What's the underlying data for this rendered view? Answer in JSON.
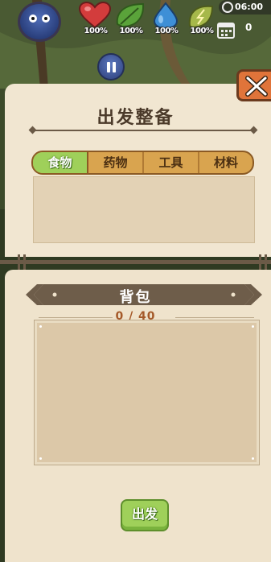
{
  "hud": {
    "stats": [
      {
        "name": "health",
        "percent": "100%",
        "color": "#d33c3c"
      },
      {
        "name": "hunger",
        "percent": "100%",
        "color": "#5aa33a"
      },
      {
        "name": "thirst",
        "percent": "100%",
        "color": "#3e8fd6"
      },
      {
        "name": "energy",
        "percent": "100%",
        "color": "#a6b84a"
      }
    ],
    "clock": "06:00",
    "day_count": "0"
  },
  "prep": {
    "title": "出发整备",
    "tabs": [
      "食物",
      "药物",
      "工具",
      "材料"
    ],
    "active_tab": 0
  },
  "backpack": {
    "title": "背包",
    "capacity": "0 / 40"
  },
  "actions": {
    "depart_label": "出发"
  },
  "colors": {
    "panel": "#f1e6d1",
    "tab_bar": "#d9a44f",
    "active_tab": "#9fd05a",
    "close_button": "#e0743a",
    "banner": "#6e5d4a"
  }
}
